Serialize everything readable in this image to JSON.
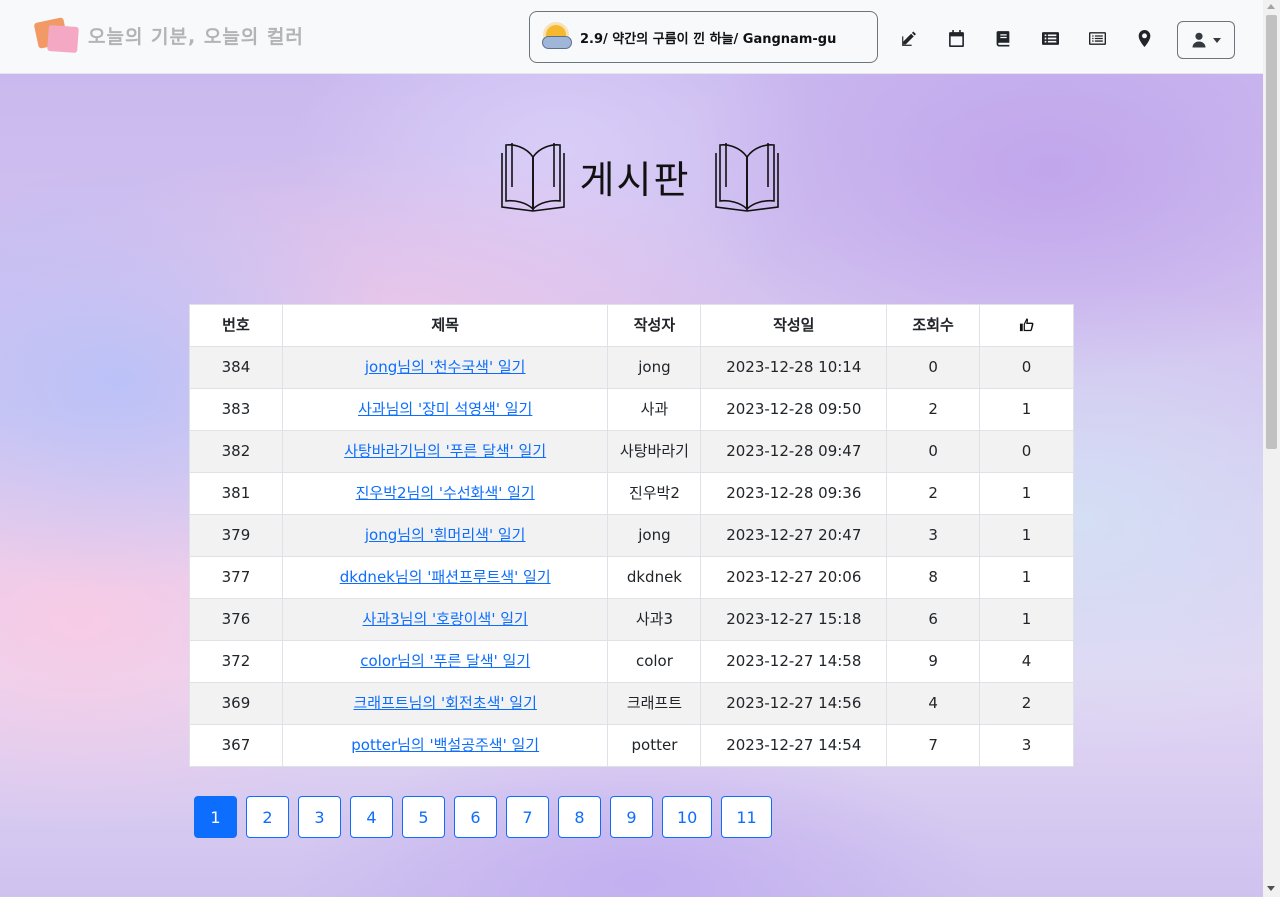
{
  "header": {
    "brand": "오늘의 기분, 오늘의 컬러",
    "weather": "2.9/ 약간의 구름이 낀 하늘/ Gangnam-gu",
    "nav_icons": [
      "edit-icon",
      "calendar-icon",
      "book-icon",
      "list-alt-icon",
      "list-outline-icon",
      "location-pin-icon"
    ],
    "user_menu_icon": "user-icon"
  },
  "board": {
    "title": "게시판",
    "columns": {
      "no": "번호",
      "title": "제목",
      "author": "작성자",
      "date": "작성일",
      "views": "조회수",
      "likes_icon": "thumbs-up-icon"
    },
    "rows": [
      {
        "no": "384",
        "title": "jong님의 '천수국색' 일기",
        "author": "jong",
        "date": "2023-12-28 10:14",
        "views": "0",
        "likes": "0"
      },
      {
        "no": "383",
        "title": "사과님의 '장미 석영색' 일기",
        "author": "사과",
        "date": "2023-12-28 09:50",
        "views": "2",
        "likes": "1"
      },
      {
        "no": "382",
        "title": "사탕바라기님의 '푸른 달색' 일기",
        "author": "사탕바라기",
        "date": "2023-12-28 09:47",
        "views": "0",
        "likes": "0"
      },
      {
        "no": "381",
        "title": "진우박2님의 '수선화색' 일기",
        "author": "진우박2",
        "date": "2023-12-28 09:36",
        "views": "2",
        "likes": "1"
      },
      {
        "no": "379",
        "title": "jong님의 '흰머리색' 일기",
        "author": "jong",
        "date": "2023-12-27 20:47",
        "views": "3",
        "likes": "1"
      },
      {
        "no": "377",
        "title": "dkdnek님의 '패션프루트색' 일기",
        "author": "dkdnek",
        "date": "2023-12-27 20:06",
        "views": "8",
        "likes": "1"
      },
      {
        "no": "376",
        "title": "사과3님의 '호랑이색' 일기",
        "author": "사과3",
        "date": "2023-12-27 15:18",
        "views": "6",
        "likes": "1"
      },
      {
        "no": "372",
        "title": "color님의 '푸른 달색' 일기",
        "author": "color",
        "date": "2023-12-27 14:58",
        "views": "9",
        "likes": "4"
      },
      {
        "no": "369",
        "title": "크래프트님의 '회전초색' 일기",
        "author": "크래프트",
        "date": "2023-12-27 14:56",
        "views": "4",
        "likes": "2"
      },
      {
        "no": "367",
        "title": "potter님의 '백설공주색' 일기",
        "author": "potter",
        "date": "2023-12-27 14:54",
        "views": "7",
        "likes": "3"
      }
    ]
  },
  "pagination": {
    "pages": [
      "1",
      "2",
      "3",
      "4",
      "5",
      "6",
      "7",
      "8",
      "9",
      "10",
      "11"
    ],
    "current": "1"
  },
  "colors": {
    "accent": "#0d6efd",
    "navbar_bg": "#f8f9fa",
    "brand_text": "#b3b3b8"
  }
}
